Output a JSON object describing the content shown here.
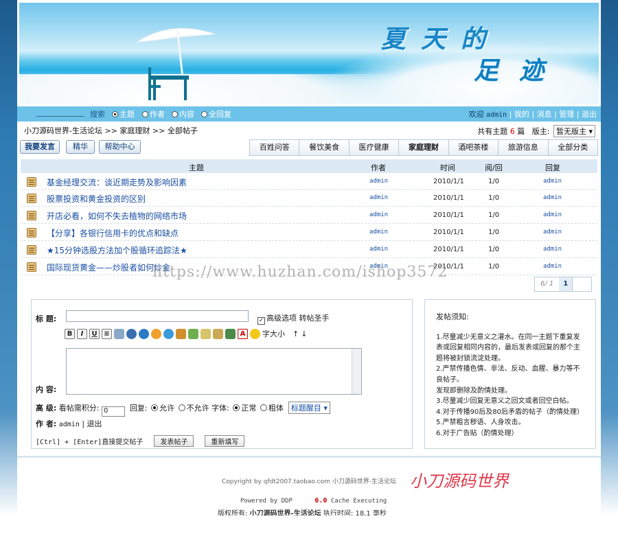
{
  "banner": {
    "title_line1": "夏天的",
    "title_line2": "足迹"
  },
  "search": {
    "label": "搜索",
    "options": [
      "主题",
      "作者",
      "内容",
      "全回复"
    ],
    "welcome": "欢迎",
    "user": "admin",
    "links": [
      "我的",
      "消息",
      "管理",
      "退出"
    ]
  },
  "breadcrumb": {
    "site": "小刀源码世界-生活论坛",
    "forum": "家庭理财",
    "current": "全部帖子",
    "sep": ">>"
  },
  "stats": {
    "prefix": "共有主题",
    "count": "6",
    "suffix": "篇",
    "mod_label": "版主:",
    "mod_value": "暂无版主"
  },
  "actions": {
    "post": "我要发言",
    "digest": "精华",
    "help": "帮助中心"
  },
  "categories": [
    {
      "label": "百姓问答",
      "active": false
    },
    {
      "label": "餐饮美食",
      "active": false
    },
    {
      "label": "医疗健康",
      "active": false
    },
    {
      "label": "家庭理财",
      "active": true
    },
    {
      "label": "酒吧茶楼",
      "active": false
    },
    {
      "label": "旅游信息",
      "active": false
    },
    {
      "label": "全部分类",
      "active": false
    }
  ],
  "table": {
    "headers": {
      "topic": "主题",
      "author": "作者",
      "time": "时间",
      "views": "阅/回",
      "reply": "回复"
    },
    "rows": [
      {
        "title": "基金经理交流：谈近期走势及影响因素",
        "author": "admin",
        "date": "2010/1/1",
        "stat": "1/0",
        "reply": "admin"
      },
      {
        "title": "股票投资和黄金投资的区别",
        "author": "admin",
        "date": "2010/1/1",
        "stat": "1/0",
        "reply": "admin"
      },
      {
        "title": "开店必看，如何不失去植物的网络市场",
        "author": "admin",
        "date": "2010/1/1",
        "stat": "1/0",
        "reply": "admin"
      },
      {
        "title": "【分享】各银行信用卡的优点和缺点",
        "author": "admin",
        "date": "2010/1/1",
        "stat": "1/0",
        "reply": "admin"
      },
      {
        "title": "★15分钟选股方法加个股循环追踪法★",
        "author": "admin",
        "date": "2010/1/1",
        "stat": "1/0",
        "reply": "admin"
      },
      {
        "title": "国际现货黄金——炒股者如何炒金",
        "author": "admin",
        "date": "2010/1/1",
        "stat": "1/0",
        "reply": "admin"
      }
    ]
  },
  "pager": {
    "info": "6/ 1",
    "current": "1"
  },
  "watermark": "https://www.huzhan.com/ishop3572",
  "form": {
    "title_label": "标 题:",
    "advanced": "高级选项",
    "advanced_link": "转帖圣手",
    "font_size": "字大小",
    "up": "↑",
    "down": "↓",
    "content_label": "内 容:",
    "level_label": "高 级:",
    "points_label": "看帖需积分:",
    "points_value": "0",
    "reply_label": "回复:",
    "allow": "允许",
    "disallow": "不允许",
    "font_label": "字体:",
    "normal": "正常",
    "bold": "粗体",
    "title_color": "标题醒目",
    "author_label": "作 者:",
    "author": "admin",
    "logout": "退出",
    "shortcut": "[Ctrl] + [Enter]直接提交帖子",
    "submit": "发表帖子",
    "reset": "重新填写"
  },
  "notice": {
    "heading": "发帖须知:",
    "lines": [
      "1.尽量减少无意义之灌水。在同一主题下重复发",
      "表或回复相同内容的，最后发表或回复的那个主",
      "题将被封锁流淀处理。",
      "2.严禁传播色情、非法、反动、血腥、暴力等不",
      "良帖子。",
      "发现即删除及酌情处理。",
      "3.尽量减少回复无意义之回文或者回空白帖。",
      "4.对于传播90后及80后矛盾的帖子（酌情处理）",
      "5.严禁粗言秽语、人身攻击。",
      "6.对于广告贴（酌情处理）"
    ]
  },
  "footer": {
    "copyright": "Copyright by qfdt2007.taobao.com 小刀源码世界-生活论坛",
    "signature": "小刀源码世界",
    "powered_prefix": "Powered by DDP",
    "powered_version": "6.0",
    "powered_suffix": "Cache Executing",
    "rights_prefix": "版权所有:",
    "rights_name": "小刀源码世界-生活论坛",
    "exec_label": "执行时间:",
    "exec_value": "18.1 毫秒"
  },
  "colors": {
    "link": "#1a4fa3",
    "header_bg": "#dce9f5",
    "accent_red": "#cc0000"
  }
}
